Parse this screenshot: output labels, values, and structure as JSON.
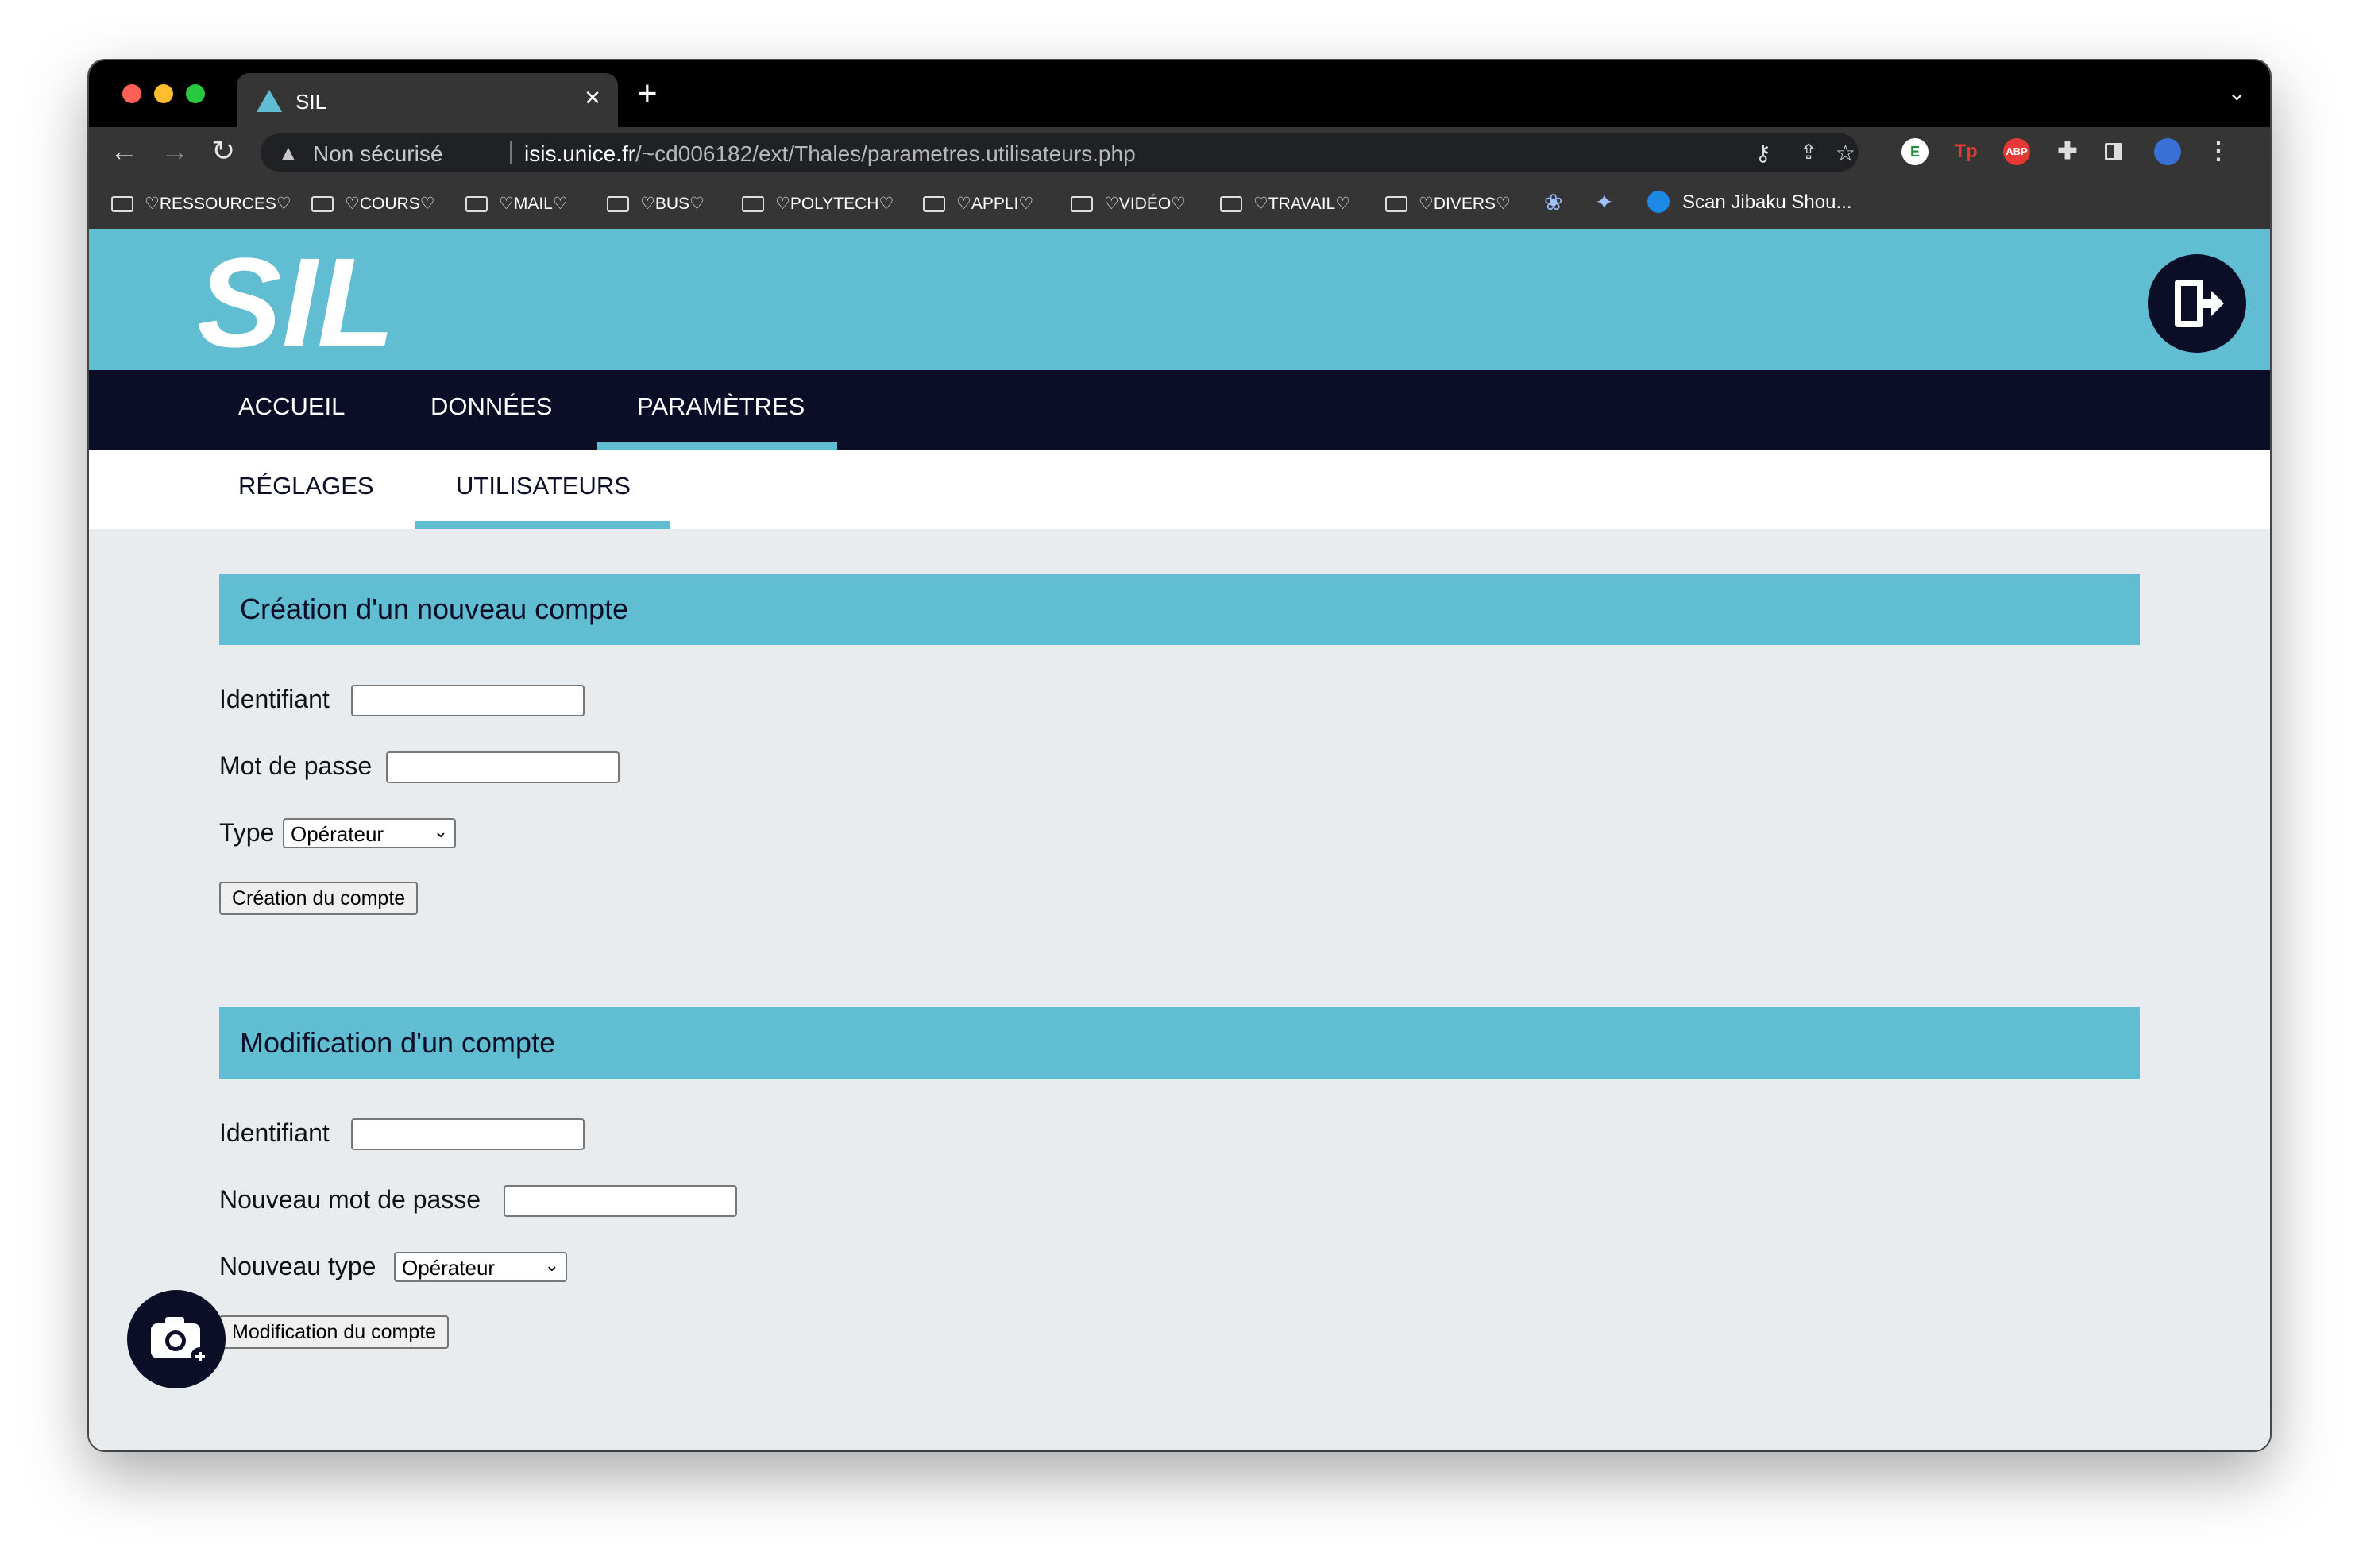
{
  "browser": {
    "tab_title": "SIL",
    "tab_close": "×",
    "new_tab": "+",
    "not_secure": "Non sécurisé",
    "url_host": "isis.unice.fr",
    "url_path": "/~cd006182/ext/Thales/parametres.utilisateurs.php",
    "bookmarks": [
      "♡RESSOURCES♡",
      "♡COURS♡",
      "♡MAIL♡",
      "♡BUS♡",
      "♡POLYTECH♡",
      "♡APPLI♡",
      "♡VIDÉO♡",
      "♡TRAVAIL♡",
      "♡DIVERS♡"
    ],
    "bookmark_link": "Scan Jibaku Shou...",
    "extensions": [
      "E",
      "Tp",
      "ABP"
    ]
  },
  "site": {
    "logo": "SIL",
    "nav": [
      "ACCUEIL",
      "DONNÉES",
      "PARAMÈTRES"
    ],
    "nav_active": "PARAMÈTRES",
    "subnav": [
      "RÉGLAGES",
      "UTILISATEURS"
    ],
    "subnav_active": "UTILISATEURS"
  },
  "create_form": {
    "title": "Création d'un nouveau compte",
    "id_label": "Identifiant",
    "id_value": "",
    "password_label": "Mot de passe",
    "password_value": "",
    "type_label": "Type",
    "type_selected": "Opérateur",
    "submit": "Création du compte"
  },
  "modify_form": {
    "title": "Modification d'un compte",
    "id_label": "Identifiant",
    "id_value": "",
    "password_label": "Nouveau mot de passe",
    "password_value": "",
    "type_label": "Nouveau type",
    "type_selected": "Opérateur",
    "submit": "Modification du compte"
  },
  "colors": {
    "accent": "#61bdd1",
    "navy": "#0b0e26",
    "page_bg": "#e9ecef"
  }
}
